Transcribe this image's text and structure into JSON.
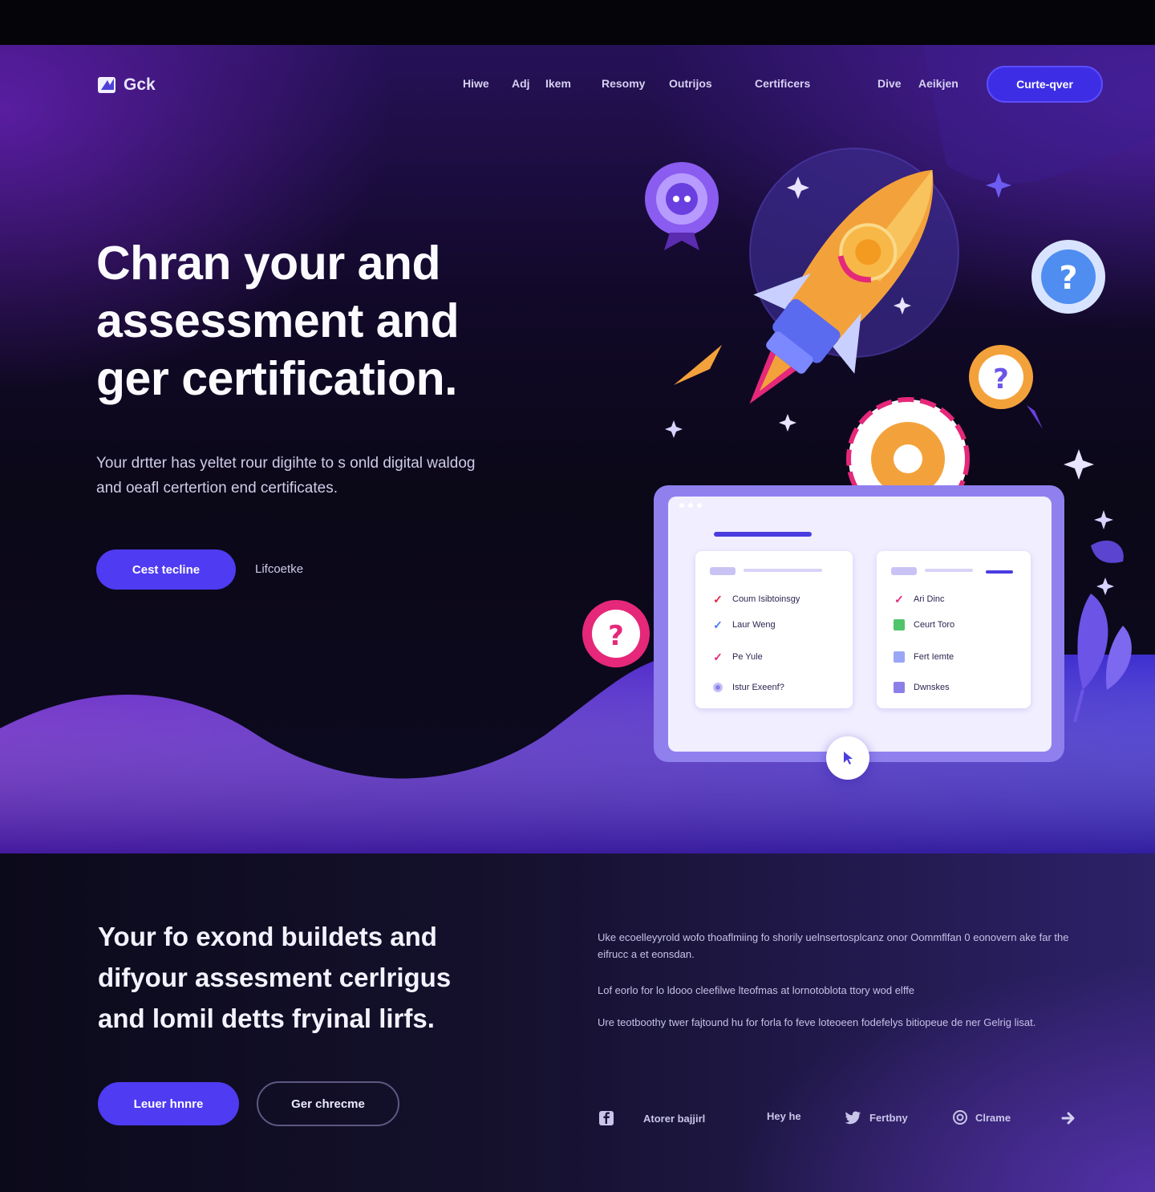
{
  "brand": {
    "name": "Gck"
  },
  "nav": {
    "links": [
      "Hiwe",
      "Adj",
      "Ikem",
      "Resomy",
      "Outrijos",
      "Certificers",
      "Dive",
      "Aeikjen"
    ],
    "cta": "Curte-qver"
  },
  "hero": {
    "title_lines": [
      "Chran your and",
      "assessment and",
      "ger certification."
    ],
    "subtitle_lines": [
      "Your drtter has yeltet rour digihte to s onld digital waldog",
      "and oeafl certertion end certificates."
    ],
    "primary_button": "Cest tecline",
    "secondary_link": "Lifcoetke"
  },
  "app_card": {
    "left_panel": [
      {
        "icon": "check-icon",
        "label": "Coum Isibtoinsgy"
      },
      {
        "icon": "check-icon",
        "label": "Laur Weng"
      },
      {
        "icon": "check-icon",
        "label": "Pe Yule"
      },
      {
        "icon": "radio-icon",
        "label": "Istur Exeenf?"
      }
    ],
    "right_panel": [
      {
        "icon": "check-icon",
        "label": "Ari Dinc"
      },
      {
        "icon": "square-icon",
        "label": "Ceurt Toro"
      },
      {
        "icon": "square-icon",
        "label": "Fert Iemte"
      },
      {
        "icon": "square-icon",
        "label": "Dwnskes"
      }
    ]
  },
  "section2": {
    "title_lines": [
      "Your fo exond buildets and",
      "difyour assesment cerlrigus",
      "and lomil detts fryinal lirfs."
    ],
    "paragraphs": [
      "Uke ecoelleyyrold wofo thoaflmiing fo shorily uelnsertosplcanz onor Oommflfan 0 eonovern ake far the eifrucc a et eonsdan.",
      "Lof eorlo for lo ldooo cleefilwe lteofmas at lornotoblota ttory wod elffe",
      "Ure teotboothy twer fajtound hu for forla fo feve loteoeen fodefelys bitiopeue de ner Gelrig lisat."
    ],
    "primary_button": "Leuer hnnre",
    "secondary_button": "Ger chrecme"
  },
  "social": [
    {
      "icon": "facebook-icon",
      "label": "Atorer bajjirl"
    },
    {
      "icon": "",
      "label": "Hey he"
    },
    {
      "icon": "twitter-icon",
      "label": "Fertbny"
    },
    {
      "icon": "instagram-icon",
      "label": "Clrame"
    },
    {
      "icon": "arrow-icon",
      "label": ""
    }
  ],
  "colors": {
    "accent": "#4f3bf2",
    "hero_bg": "#0b0818",
    "card": "#8f80ee",
    "check_red": "#e0224a",
    "check_blue": "#4a7bf2",
    "badge_orange": "#f3a23b",
    "badge_pink": "#e5287a"
  }
}
